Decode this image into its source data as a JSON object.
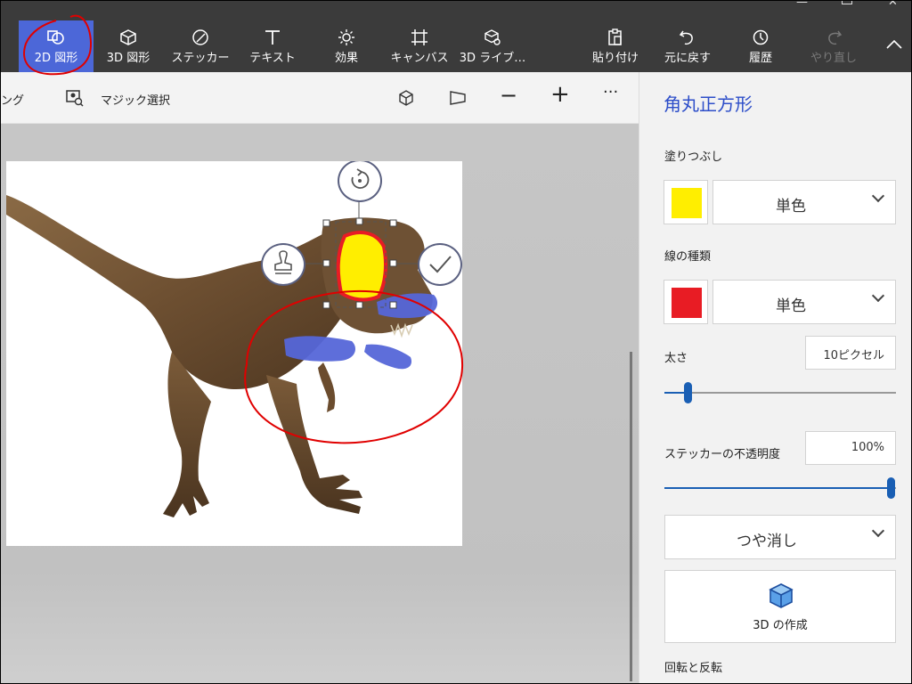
{
  "ribbon": {
    "tabs": [
      {
        "label": "2D 図形",
        "icon": "2d-shapes-icon"
      },
      {
        "label": "3D 図形",
        "icon": "3d-shapes-icon"
      },
      {
        "label": "ステッカー",
        "icon": "sticker-icon"
      },
      {
        "label": "テキスト",
        "icon": "text-icon"
      },
      {
        "label": "効果",
        "icon": "effects-icon"
      },
      {
        "label": "キャンバス",
        "icon": "canvas-icon"
      },
      {
        "label": "3D ライブ…",
        "icon": "3d-library-icon"
      },
      {
        "label": "貼り付け",
        "icon": "paste-icon"
      },
      {
        "label": "元に戻す",
        "icon": "undo-icon"
      },
      {
        "label": "履歴",
        "icon": "history-icon"
      },
      {
        "label": "やり直し",
        "icon": "redo-icon"
      }
    ]
  },
  "toolbar": {
    "crop_partial": "ング",
    "magic_select": "マジック選択"
  },
  "panel": {
    "title": "角丸正方形",
    "fill_label": "塗りつぶし",
    "fill_color": "#ffee00",
    "fill_type": "単色",
    "line_label": "線の種類",
    "line_color": "#e81c24",
    "line_type": "単色",
    "thickness_label": "太さ",
    "thickness_value": "10ピクセル",
    "thickness_level": 0.1,
    "opacity_label": "ステッカーの不透明度",
    "opacity_value": "100%",
    "opacity_level": 1.0,
    "finish": "つや消し",
    "make3d": "3D の作成",
    "rotate_flip": "回転と反転"
  },
  "colors": {
    "accent": "#4c67d8",
    "ribbon": "#3b3b3b",
    "annotation": "#e00000"
  }
}
